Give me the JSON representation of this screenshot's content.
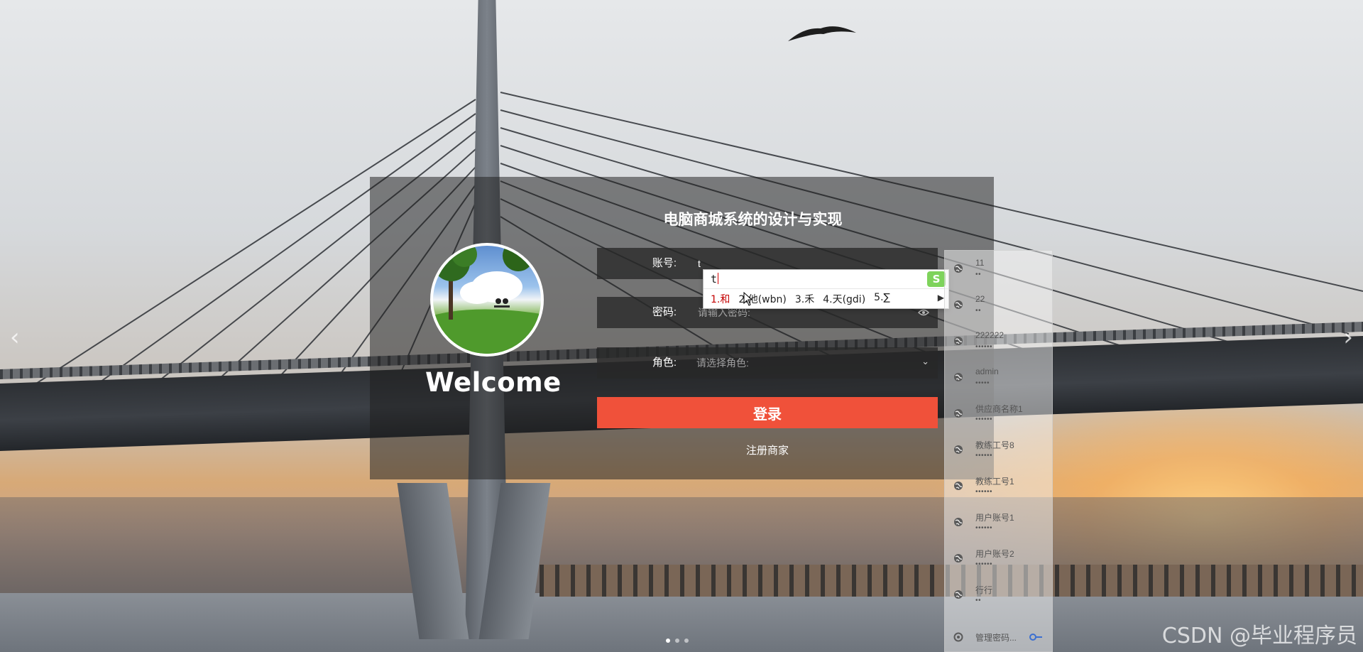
{
  "login": {
    "title": "电脑商城系统的设计与实现",
    "welcome": "Welcome",
    "account_label": "账号:",
    "account_value": "t",
    "password_label": "密码:",
    "password_placeholder": "请输入密码:",
    "role_label": "角色:",
    "role_placeholder": "请选择角色:",
    "login_button": "登录",
    "register_link": "注册商家",
    "accent_color": "#f0513a"
  },
  "ime": {
    "composition": "t",
    "candidates": [
      "1.和",
      "2.他(wbn)",
      "3.禾",
      "4.天(gdi)",
      "5.∑"
    ],
    "logo": "S"
  },
  "password_dropdown": {
    "items": [
      {
        "user": "11",
        "mask": "••"
      },
      {
        "user": "22",
        "mask": "••"
      },
      {
        "user": "222222",
        "mask": "••••••"
      },
      {
        "user": "admin",
        "mask": "•••••"
      },
      {
        "user": "供应商名称1",
        "mask": "••••••"
      },
      {
        "user": "教练工号8",
        "mask": "••••••"
      },
      {
        "user": "教练工号1",
        "mask": "••••••"
      },
      {
        "user": "用户账号1",
        "mask": "••••••"
      },
      {
        "user": "用户账号2",
        "mask": "••••••"
      },
      {
        "user": "行行",
        "mask": "••"
      }
    ],
    "manage_label": "管理密码..."
  },
  "carousel": {
    "prev_icon": "chevron-left-icon",
    "next_icon": "chevron-right-icon",
    "prev_glyph": "‹",
    "next_glyph": "›"
  },
  "watermark": "CSDN @毕业程序员"
}
